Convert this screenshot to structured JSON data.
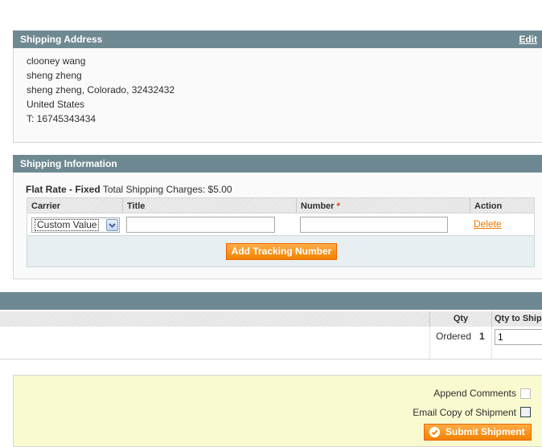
{
  "shipping_address": {
    "title": "Shipping Address",
    "edit_label": "Edit",
    "lines": [
      "clooney wang",
      "sheng zheng",
      "sheng zheng, Colorado, 32432432",
      "United States",
      "T: 16745343434"
    ]
  },
  "shipping_information": {
    "title": "Shipping Information",
    "method": "Flat Rate - Fixed",
    "charges": "Total Shipping Charges: $5.00",
    "columns": {
      "carrier": "Carrier",
      "title": "Title",
      "number": "Number",
      "required_mark": "*",
      "action": "Action"
    },
    "row": {
      "carrier_value": "Custom Value",
      "title_value": "",
      "number_value": "",
      "action_label": "Delete"
    },
    "add_button": "Add Tracking Number"
  },
  "items": {
    "qty_header": "Qty",
    "qty_to_ship_header": "Qty to Ship",
    "ordered_label": "Ordered",
    "ordered_value": "1",
    "qty_to_ship_value": "1"
  },
  "footer": {
    "append_comments": "Append Comments",
    "email_copy": "Email Copy of Shipment",
    "submit_button": "Submit Shipment"
  },
  "colors": {
    "header_bar": "#6f8992",
    "accent_orange": "#f18200",
    "link_orange": "#ea7601",
    "footer_bg": "#fafad0"
  },
  "icons": {
    "select_arrow": "chevron-down-icon",
    "submit_icon": "check-circle-icon"
  }
}
